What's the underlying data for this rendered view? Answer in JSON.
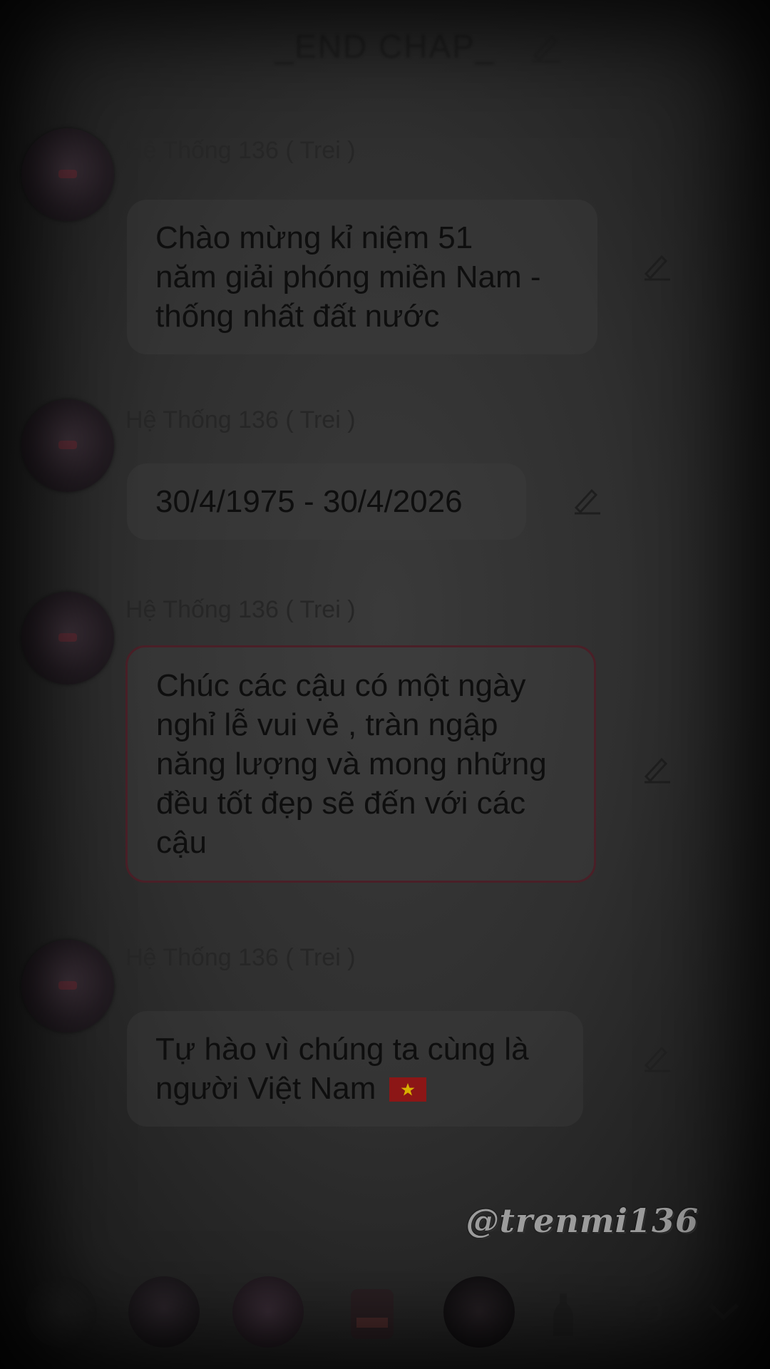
{
  "header": {
    "title": "_END CHAP_",
    "edit_icon": "pencil-icon"
  },
  "messages": [
    {
      "sender": "Hệ Thống 136 ( Trei )",
      "lines": [
        "Chào mừng kỉ niệm 51",
        "năm giải phóng miền Nam -",
        "thống nhất đất nước"
      ]
    },
    {
      "sender": "Hệ Thống 136 ( Trei )",
      "lines": [
        "30/4/1975 - 30/4/2026"
      ]
    },
    {
      "sender": "Hệ Thống 136 ( Trei )",
      "lines": [
        "Chúc các cậu có một ngày",
        "nghỉ lễ vui vẻ , tràn ngập",
        "năng lượng và mong những",
        "đều tốt đẹp sẽ đến với các",
        "cậu"
      ]
    },
    {
      "sender": "Hệ Thống 136 ( Trei )",
      "lines": [
        "Tự hào vì chúng ta cùng là",
        "người Việt Nam"
      ],
      "flag": "vietnam-flag-icon"
    }
  ],
  "watermark": "@trenmi136",
  "bottom_bar": {
    "items": [
      "avatar-icon",
      "avatar-icon",
      "avatar-icon",
      "character-icon",
      "avatar-icon",
      "bottle-icon",
      "search-icon",
      "chevron-down-icon"
    ]
  },
  "colors": {
    "background": "#2f2f2f",
    "bubble_outline": "#4a1f27",
    "flag_red": "#8c1616",
    "flag_star": "#d8b000"
  }
}
